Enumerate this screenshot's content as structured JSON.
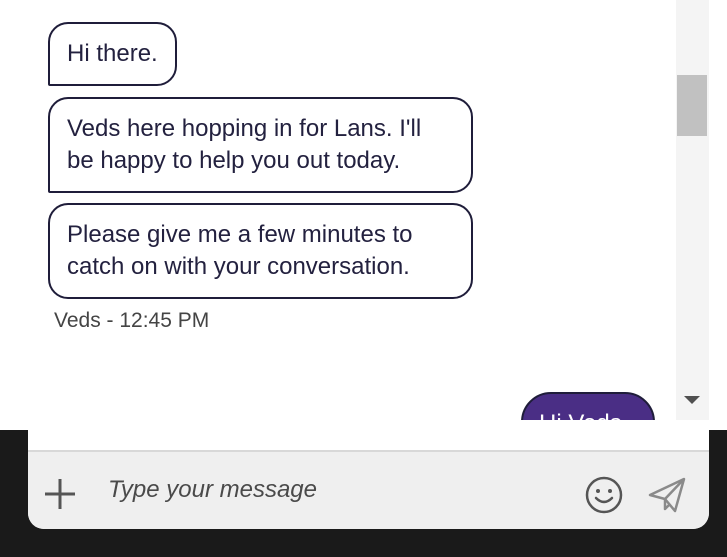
{
  "messages": [
    {
      "text": "Hi there."
    },
    {
      "text": "Veds here hopping in for Lans. I'll be happy to help you out today."
    },
    {
      "text": "Please give me a few minutes to catch on with your conversation."
    }
  ],
  "timestamp": "Veds - 12:45 PM",
  "outgoing_partial": "Hi Veds",
  "composer": {
    "placeholder": "Type your message",
    "add_icon": "plus-icon",
    "emoji_icon": "smiley-icon",
    "send_icon": "paper-plane-icon"
  },
  "colors": {
    "bubble_border": "#1f1d3a",
    "outgoing_bubble": "#4a2e85",
    "composer_bg": "#efefef",
    "backdrop_dark": "#1a1a1a"
  }
}
